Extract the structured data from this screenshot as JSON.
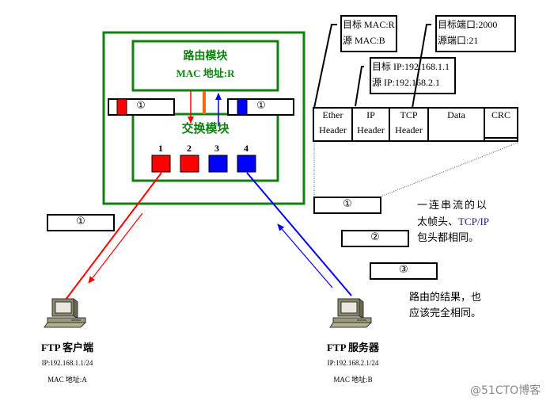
{
  "router": {
    "title": "路由模块",
    "mac": "MAC 地址:R",
    "switch_title": "交换模块",
    "ports": [
      "1",
      "2",
      "3",
      "4"
    ],
    "port_colors": [
      "#ff0000",
      "#ff0000",
      "#0000ff",
      "#0000ff"
    ],
    "left_frame_label": "①",
    "right_frame_label": "①"
  },
  "packet": {
    "fields": [
      {
        "line1": "Ether",
        "line2": "Header"
      },
      {
        "line1": "IP",
        "line2": "Header"
      },
      {
        "line1": "TCP",
        "line2": "Header"
      },
      {
        "line1": "Data",
        "line2": ""
      },
      {
        "line1": "CRC",
        "line2": ""
      }
    ],
    "ether_callout": [
      "目标 MAC:R",
      "源 MAC:B"
    ],
    "ip_callout": [
      "目标 IP:192.168.1.1",
      "源 IP:192.168.2.1"
    ],
    "tcp_callout": [
      "目标端口:2000",
      "源端口:21"
    ]
  },
  "flow_boxes": [
    "①",
    "②",
    "③"
  ],
  "left_link_box": "①",
  "notes": {
    "note1_line1": "一连串流的以",
    "note1_line2_a": "太帧头、",
    "note1_line2_b": "TCP/IP",
    "note1_line3": "包头都相同。",
    "note2_line1": "路由的结果，也",
    "note2_line2": "应该完全相同。"
  },
  "hosts": {
    "client": {
      "title": "FTP 客户端",
      "ip": "IP:192.168.1.1/24",
      "mac": "MAC 地址:A"
    },
    "server": {
      "title": "FTP 服务器",
      "ip": "IP:192.168.2.1/24",
      "mac": "MAC 地址:B"
    }
  },
  "colors": {
    "green": "#108010",
    "red": "#ff0000",
    "blue": "#0000ff",
    "orange": "#ff6600"
  },
  "watermark": "@51CTO博客"
}
